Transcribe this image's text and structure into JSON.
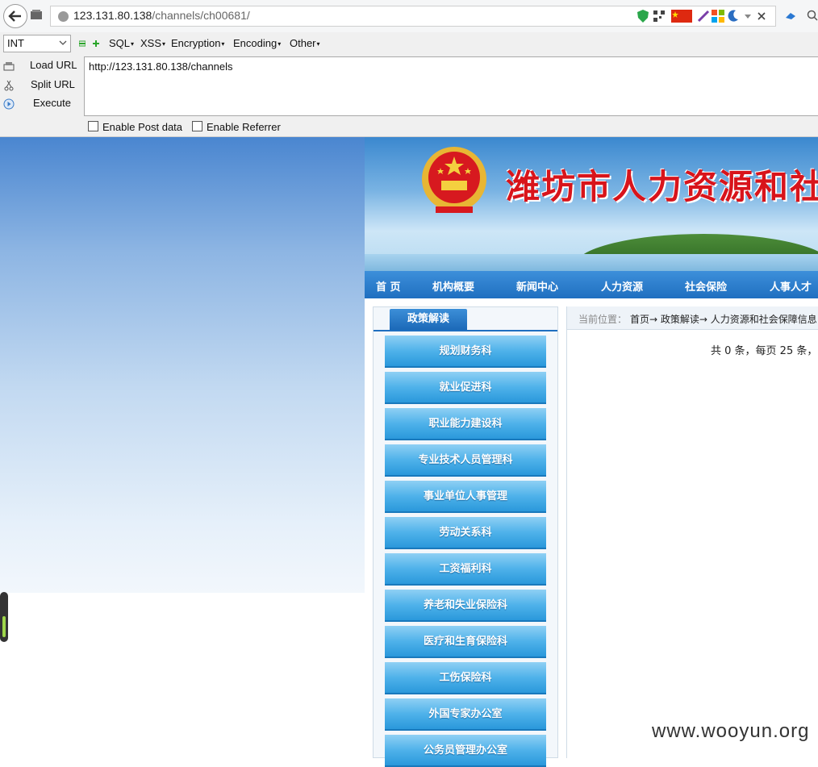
{
  "browser": {
    "url_host": "123.131.80.138",
    "url_path": "/channels/ch00681/"
  },
  "hackbar": {
    "type_select": "INT",
    "menus": [
      "SQL",
      "XSS",
      "Encryption",
      "Encoding",
      "Other"
    ],
    "buttons": {
      "load": "Load URL",
      "split": "Split URL",
      "execute": "Execute"
    },
    "url_value": "http://123.131.80.138/channels",
    "enable_post": "Enable Post data",
    "enable_referrer": "Enable Referrer"
  },
  "site": {
    "title": "潍坊市人力资源和社",
    "nav": [
      "首 页",
      "机构概要",
      "新闻中心",
      "人力资源",
      "社会保险",
      "人事人才"
    ],
    "sidebar_title": "政策解读",
    "sidebar_items": [
      "规划财务科",
      "就业促进科",
      "职业能力建设科",
      "专业技术人员管理科",
      "事业单位人事管理",
      "劳动关系科",
      "工资福利科",
      "养老和失业保险科",
      "医疗和生育保险科",
      "工伤保险科",
      "外国专家办公室",
      "公务员管理办公室"
    ],
    "breadcrumb_label": "当前位置：",
    "breadcrumb": "首页→ 政策解读→ 人力资源和社会保障信息",
    "count_text": "共 0 条，每页 25 条，"
  },
  "watermark": "www.wooyun.org",
  "colors": {
    "title_red": "#d8141b",
    "nav_blue": "#1f6fc0",
    "side_item_blue": "#4fb2ea"
  }
}
